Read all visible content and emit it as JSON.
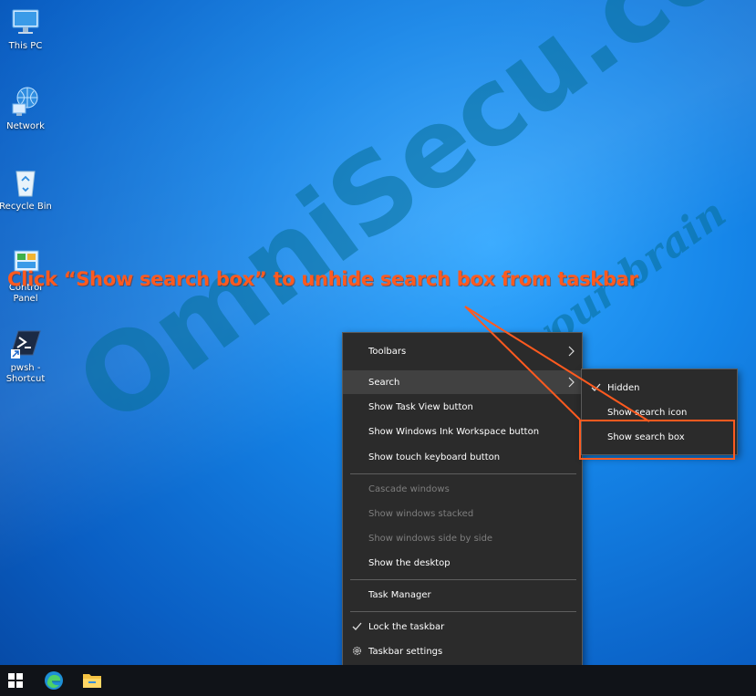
{
  "desktop": {
    "icons": [
      {
        "label": "This PC",
        "icon": "this-pc-icon"
      },
      {
        "label": "Network",
        "icon": "network-icon"
      },
      {
        "label": "Recycle Bin",
        "icon": "recycle-bin-icon"
      },
      {
        "label": "Control Panel",
        "icon": "control-panel-icon"
      },
      {
        "label": "pwsh - Shortcut",
        "icon": "powershell-icon"
      }
    ]
  },
  "annotation": {
    "headline": "Click “Show search box” to unhide search box from taskbar",
    "color": "#ff5a1f"
  },
  "watermark": {
    "text": "OmniSecu.com",
    "tagline": "feed your brain"
  },
  "context_menu": {
    "items": [
      {
        "label": "Toolbars",
        "has_submenu": true
      },
      {
        "label": "Search",
        "has_submenu": true
      },
      {
        "label": "Show Task View button"
      },
      {
        "label": "Show Windows Ink Workspace button"
      },
      {
        "label": "Show touch keyboard button"
      },
      {
        "label": "Cascade windows",
        "disabled": true
      },
      {
        "label": "Show windows stacked",
        "disabled": true
      },
      {
        "label": "Show windows side by side",
        "disabled": true
      },
      {
        "label": "Show the desktop"
      },
      {
        "label": "Task Manager"
      },
      {
        "label": "Lock the taskbar",
        "checked": true
      },
      {
        "label": "Taskbar settings",
        "icon": "gear-icon"
      }
    ]
  },
  "search_submenu": {
    "items": [
      {
        "label": "Hidden",
        "checked": true
      },
      {
        "label": "Show search icon"
      },
      {
        "label": "Show search box"
      }
    ]
  },
  "taskbar": {
    "items": [
      "start-icon",
      "edge-icon",
      "file-explorer-icon"
    ]
  }
}
